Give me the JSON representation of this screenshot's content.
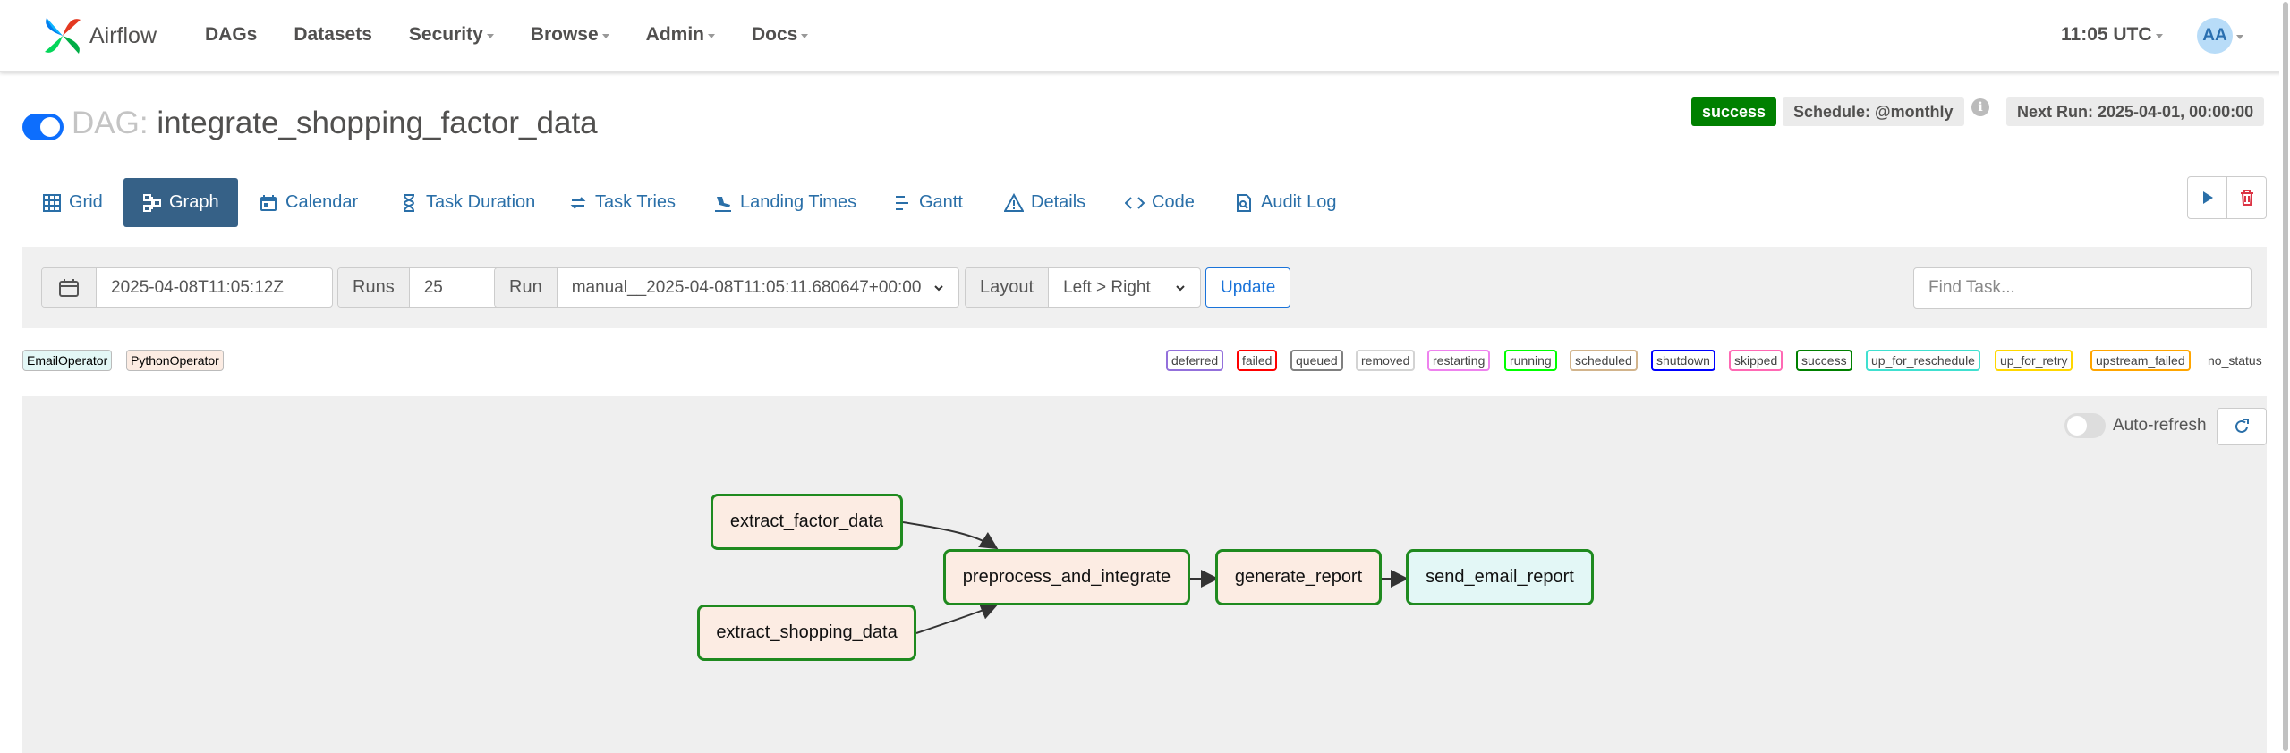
{
  "nav": {
    "brand": "Airflow",
    "items": [
      "DAGs",
      "Datasets",
      "Security",
      "Browse",
      "Admin",
      "Docs"
    ],
    "time": "11:05 UTC",
    "user_initials": "AA"
  },
  "dag": {
    "prefix": "DAG:",
    "name": "integrate_shopping_factor_data",
    "paused": false,
    "state": "success",
    "schedule": "Schedule: @monthly",
    "next_run": "Next Run: 2025-04-01, 00:00:00"
  },
  "tabs": [
    {
      "label": "Grid",
      "icon": "grid-icon",
      "active": false
    },
    {
      "label": "Graph",
      "icon": "graph-icon",
      "active": true
    },
    {
      "label": "Calendar",
      "icon": "calendar-icon",
      "active": false
    },
    {
      "label": "Task Duration",
      "icon": "hourglass-icon",
      "active": false
    },
    {
      "label": "Task Tries",
      "icon": "retry-icon",
      "active": false
    },
    {
      "label": "Landing Times",
      "icon": "landing-plane-icon",
      "active": false
    },
    {
      "label": "Gantt",
      "icon": "gantt-icon",
      "active": false
    },
    {
      "label": "Details",
      "icon": "warning-triangle-icon",
      "active": false
    },
    {
      "label": "Code",
      "icon": "code-icon",
      "active": false
    },
    {
      "label": "Audit Log",
      "icon": "file-search-icon",
      "active": false
    }
  ],
  "filters": {
    "base_date": "2025-04-08T11:05:12Z",
    "runs_label": "Runs",
    "runs_value": "25",
    "run_label": "Run",
    "run_value": "manual__2025-04-08T11:05:11.680647+00:00",
    "layout_label": "Layout",
    "layout_value": "Left > Right",
    "update_label": "Update",
    "find_placeholder": "Find Task..."
  },
  "operators": [
    {
      "label": "EmailOperator",
      "color": "#e3f7f6"
    },
    {
      "label": "PythonOperator",
      "color": "#fcece3"
    }
  ],
  "states": [
    {
      "label": "deferred",
      "color": "#9370db"
    },
    {
      "label": "failed",
      "color": "#ff0000"
    },
    {
      "label": "queued",
      "color": "#808080"
    },
    {
      "label": "removed",
      "color": "#d3d3d3"
    },
    {
      "label": "restarting",
      "color": "#ee82ee"
    },
    {
      "label": "running",
      "color": "#00ff00"
    },
    {
      "label": "scheduled",
      "color": "#d2b48c"
    },
    {
      "label": "shutdown",
      "color": "#0000ff"
    },
    {
      "label": "skipped",
      "color": "#ff69b4"
    },
    {
      "label": "success",
      "color": "#008000"
    },
    {
      "label": "up_for_reschedule",
      "color": "#40e0d0"
    },
    {
      "label": "up_for_retry",
      "color": "#ffd700"
    },
    {
      "label": "upstream_failed",
      "color": "#ffa500"
    }
  ],
  "no_status_label": "no_status",
  "graph": {
    "auto_refresh_label": "Auto-refresh",
    "auto_refresh_on": false,
    "tasks": {
      "extract_factor_data": "extract_factor_data",
      "extract_shopping_data": "extract_shopping_data",
      "preprocess_and_integrate": "preprocess_and_integrate",
      "generate_report": "generate_report",
      "send_email_report": "send_email_report"
    }
  },
  "colors": {
    "accent": "#366187",
    "link": "#2a6fa8",
    "success": "#008000"
  }
}
